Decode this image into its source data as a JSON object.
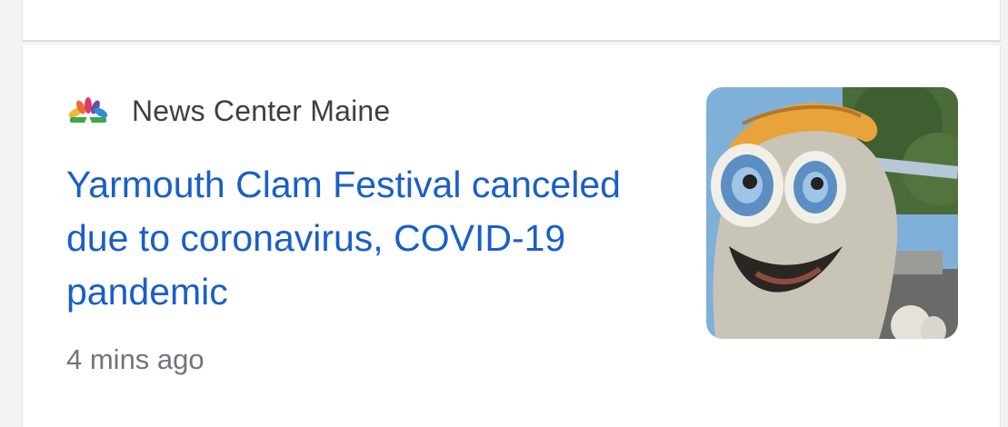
{
  "article": {
    "source": {
      "name": "News Center Maine",
      "logo_icon": "nbc-peacock-icon"
    },
    "headline": "Yarmouth Clam Festival canceled due to coronavirus, COVID-19 pandemic",
    "time": "4 mins ago",
    "thumbnail": {
      "icon": "clam-mascot-image"
    }
  },
  "colors": {
    "headline": "#1a5fc7",
    "source_text": "#3c4043",
    "time_text": "#70757a",
    "background": "#f1f3f4",
    "card": "#ffffff"
  }
}
